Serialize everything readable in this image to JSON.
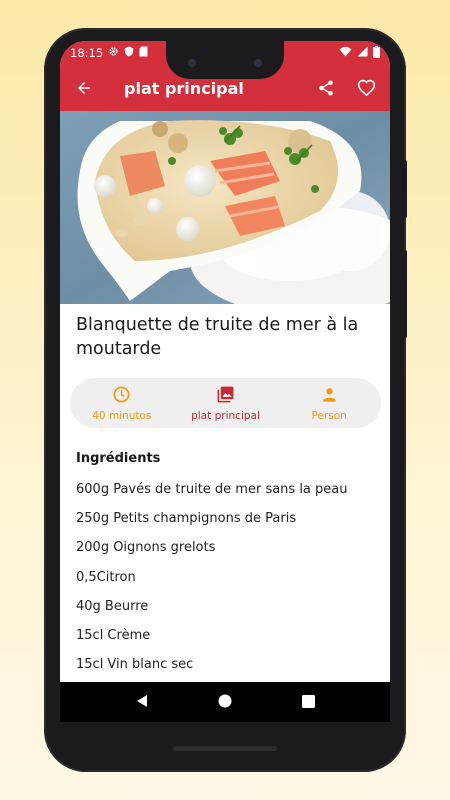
{
  "status_bar": {
    "time": "18:15",
    "left_icons": [
      "gear-icon",
      "shield-icon",
      "sd-card-icon"
    ],
    "right_icons": [
      "wifi-icon",
      "signal-icon",
      "battery-icon"
    ]
  },
  "app_bar": {
    "title": "plat principal",
    "back_icon": "arrow-back-icon",
    "actions": [
      "share-icon",
      "heart-icon"
    ]
  },
  "recipe": {
    "title": "Blanquette de truite de mer à la moutarde",
    "info": [
      {
        "icon": "clock-icon",
        "label": "40 minutos",
        "color": "#f39a0c"
      },
      {
        "icon": "image-icon",
        "label": "plat principal",
        "color": "#c62834"
      },
      {
        "icon": "person-icon",
        "label": "Person",
        "color": "#f39a0c"
      }
    ],
    "ingredients_title": "Ingrédients",
    "ingredients": [
      "600g Pavés de truite de mer sans la peau",
      "250g Petits champignons de Paris",
      "200g Oignons grelots",
      "0,5Citron",
      "40g Beurre",
      "15cl Crème",
      "15cl Vin blanc sec"
    ]
  },
  "colors": {
    "primary": "#d32f3c",
    "accent": "#f39a0c",
    "info_bar_bg": "#efeff0"
  },
  "nav_bar": [
    "back-triangle-icon",
    "home-circle-icon",
    "recents-square-icon"
  ]
}
